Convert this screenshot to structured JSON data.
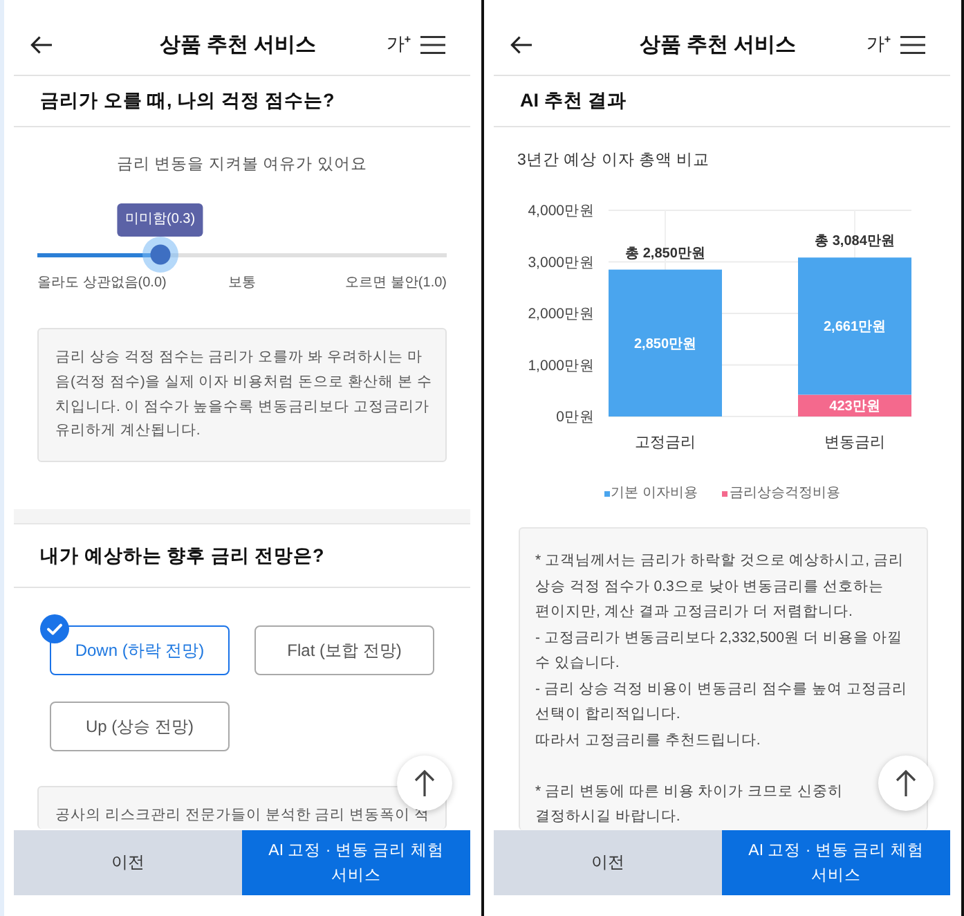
{
  "screens": [
    {
      "header": {
        "title": "상품 추천 서비스",
        "text_size_button": "가$^{+}$"
      },
      "sections": [
        {
          "title": "금리가 오를 때, 나의 걱정 점수는?",
          "blocks": [
            {
              "kind": "slider",
              "caption": "금리 변동을 지켜볼 여유가 있어요",
              "tooltip": "미미함(0.3)",
              "level": 0.3,
              "scale_labels": [
                "올라도 상관없음(0.0)",
                "보통",
                "오르면 불안(1.0)"
              ]
            },
            {
              "kind": "note",
              "text": "금리 상승 걱정 점수는 금리가 오를까 봐 우려하시는 마음(걱정 점수)을 실제 이자 비용처럼 돈으로 환산해 본 수치입니다. 이 점수가 높을수록 변동금리보다 고정금리가 유리하게 계산됩니다."
            }
          ]
        },
        {
          "title": "내가 예상하는 향후 금리 전망은?",
          "blocks": [
            {
              "kind": "options",
              "items": [
                {
                  "label": "Down (하락 전망)",
                  "selected": true
                },
                {
                  "label": "Flat (보합 전망)",
                  "selected": false
                },
                {
                  "label": "Up (상승 전망)",
                  "selected": false
                }
              ]
            },
            {
              "kind": "note",
              "text": "공사의 리스크관리 전문가들이 분석한 금리 변동폭이 적"
            }
          ]
        }
      ],
      "bottom_bar": [
        {
          "kind": "secondary",
          "label": "이전"
        },
        {
          "kind": "primary",
          "label": "AI 고정 · 변동 금리 체험 서비스"
        }
      ]
    },
    {
      "header": {
        "title": "상품 추천 서비스",
        "text_size_button": "가$^{+}$"
      },
      "sections": [
        {
          "title": "AI 추천 결과",
          "blocks": [
            {
              "kind": "chart",
              "chart_data": {
                "type": "bar",
                "title": "3년간 예상 이자 총액 비교",
                "categories": [
                  "고정금리",
                  "변동금리"
                ],
                "series": [
                  {
                    "name": "기본 이자비용",
                    "color": "#4aa5ee",
                    "values": [
                      2850,
                      2661
                    ]
                  },
                  {
                    "name": "금리상승걱정비용",
                    "color": "#f4698d",
                    "values": [
                      0,
                      423
                    ]
                  }
                ],
                "stacked": true,
                "grid": true,
                "ylim": [
                  0,
                  4000
                ],
                "yticks": [
                  {
                    "value": 0,
                    "label": "0만원"
                  },
                  {
                    "value": 1000,
                    "label": "1,000만원"
                  },
                  {
                    "value": 2000,
                    "label": "2,000만원"
                  },
                  {
                    "value": 3000,
                    "label": "3,000만원"
                  },
                  {
                    "value": 4000,
                    "label": "4,000만원"
                  }
                ],
                "value_labels": [
                  [
                    "2,850만원",
                    "2,661만원"
                  ],
                  [
                    null,
                    "423만원"
                  ]
                ],
                "annotations": [
                  "총 2,850만원",
                  "총 3,084만원"
                ]
              }
            },
            {
              "kind": "result",
              "groups": [
                [
                  "* 고객님께서는 금리가 하락할 것으로 예상하시고, 금리 상승 걱정 점수가 0.3으로 낮아 변동금리를 선호하는 편이지만, 계산 결과 고정금리가 더 저렴합니다.",
                  "- 고정금리가 변동금리보다 2,332,500원 더 비용을 아낄 수 있습니다.",
                  "- 금리 상승 걱정 비용이 변동금리 점수를 높여 고정금리 선택이 합리적입니다.",
                  "따라서 고정금리를 추천드립니다."
                ],
                [
                  "* 금리 변동에 따른 비용 차이가 크므로 신중히 결정하시길 바랍니다."
                ]
              ]
            }
          ]
        }
      ],
      "bottom_bar": [
        {
          "kind": "secondary",
          "label": "이전"
        },
        {
          "kind": "primary",
          "label": "AI 고정 · 변동 금리 체험 서비스"
        }
      ]
    }
  ]
}
